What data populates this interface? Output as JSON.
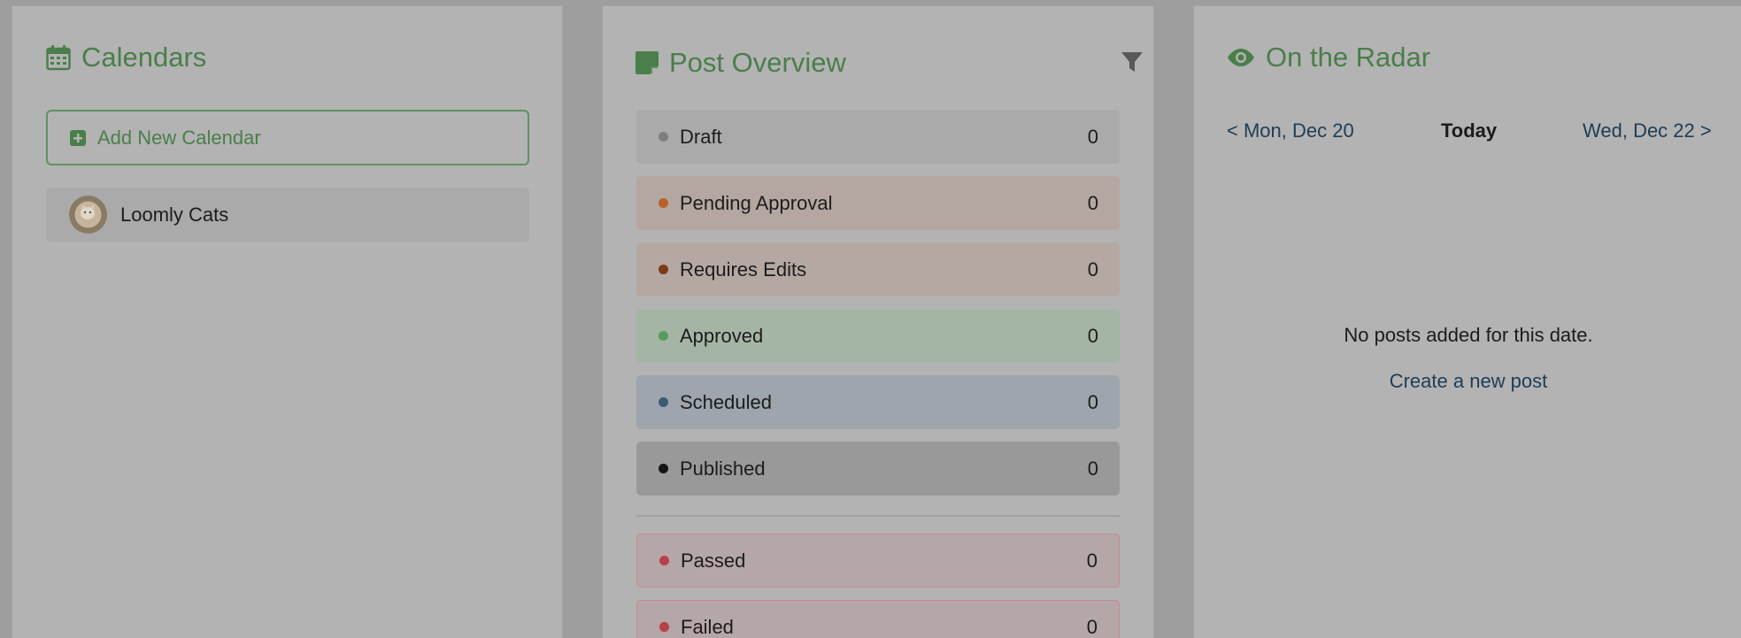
{
  "calendars": {
    "title": "Calendars",
    "add_button_label": "Add New Calendar",
    "items": [
      {
        "name": "Loomly Cats"
      }
    ]
  },
  "overview": {
    "title": "Post Overview",
    "statuses": [
      {
        "label": "Draft",
        "count": "0",
        "dot_color": "#7e7e7e",
        "bg_color": "#aaaaaa"
      },
      {
        "label": "Pending Approval",
        "count": "0",
        "dot_color": "#b8612c",
        "bg_color": "#b4a7a2"
      },
      {
        "label": "Requires Edits",
        "count": "0",
        "dot_color": "#7d3a17",
        "bg_color": "#b5a8a3"
      },
      {
        "label": "Approved",
        "count": "0",
        "dot_color": "#5a9a5a",
        "bg_color": "#a5b5a5"
      },
      {
        "label": "Scheduled",
        "count": "0",
        "dot_color": "#3b5b73",
        "bg_color": "#9fa5ac"
      },
      {
        "label": "Published",
        "count": "0",
        "dot_color": "#151515",
        "bg_color": "#999999"
      }
    ],
    "checks": [
      {
        "label": "Passed",
        "count": "0",
        "dot_color": "#b8404a",
        "bg_color": "#b5a6a8"
      },
      {
        "label": "Failed",
        "count": "0",
        "dot_color": "#b8404a",
        "bg_color": "#b5a6a8"
      }
    ]
  },
  "radar": {
    "title": "On the Radar",
    "prev_day": "< Mon, Dec 20",
    "today": "Today",
    "next_day": "Wed, Dec 22 >",
    "empty_message": "No posts added for this date.",
    "create_link": "Create a new post"
  },
  "colors": {
    "accent_green": "#4a7e4a",
    "link_blue": "#1e3d57"
  }
}
